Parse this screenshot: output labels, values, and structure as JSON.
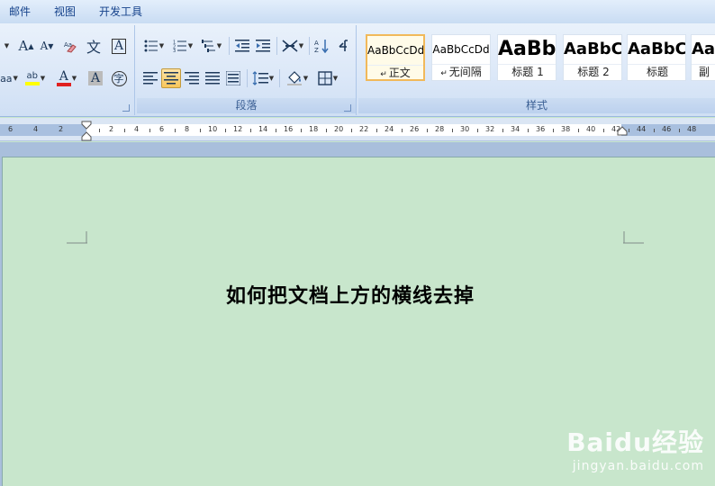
{
  "menu": {
    "tabs": [
      "邮件",
      "视图",
      "开发工具"
    ]
  },
  "ribbon": {
    "font_group": {
      "grow_label": "A",
      "shrink_label": "A",
      "phonetic_label": "文",
      "border_char_label": "A",
      "font_color_label": "A",
      "shading_char_label": "A",
      "enclose_label": "字",
      "highlight_label": "ab",
      "style_prefix": "aa"
    },
    "paragraph_group": {
      "title": "段落"
    },
    "styles_group": {
      "title": "样式",
      "styles": [
        {
          "sample": "AaBbCcDd",
          "name": "正文",
          "marker": "↵",
          "active": true
        },
        {
          "sample": "AaBbCcDd",
          "name": "无间隔",
          "marker": "↵",
          "active": false
        },
        {
          "sample": "AaBb",
          "name": "标题 1",
          "marker": "",
          "active": false
        },
        {
          "sample": "AaBbC",
          "name": "标题 2",
          "marker": "",
          "active": false
        },
        {
          "sample": "AaBbC",
          "name": "标题",
          "marker": "",
          "active": false
        },
        {
          "sample": "Aa",
          "name": "副",
          "marker": "",
          "active": false
        }
      ]
    }
  },
  "ruler": {
    "left_numbers": [
      "6",
      "4",
      "2"
    ],
    "right_numbers": [
      "2",
      "4",
      "6",
      "8",
      "10",
      "12",
      "14",
      "16",
      "18",
      "20",
      "22",
      "24",
      "26",
      "28",
      "30",
      "32",
      "34",
      "36",
      "38",
      "40",
      "42",
      "44",
      "46",
      "48"
    ]
  },
  "document": {
    "title": "如何把文档上方的横线去掉"
  },
  "watermark": {
    "logo": "Baidu经验",
    "url": "jingyan.baidu.com"
  },
  "colors": {
    "page_background": "#c8e6cc",
    "ribbon": "#dce8f8",
    "accent_selected": "#f8c65a",
    "font_color_red": "#e02020",
    "highlight_yellow": "#ffff00"
  }
}
